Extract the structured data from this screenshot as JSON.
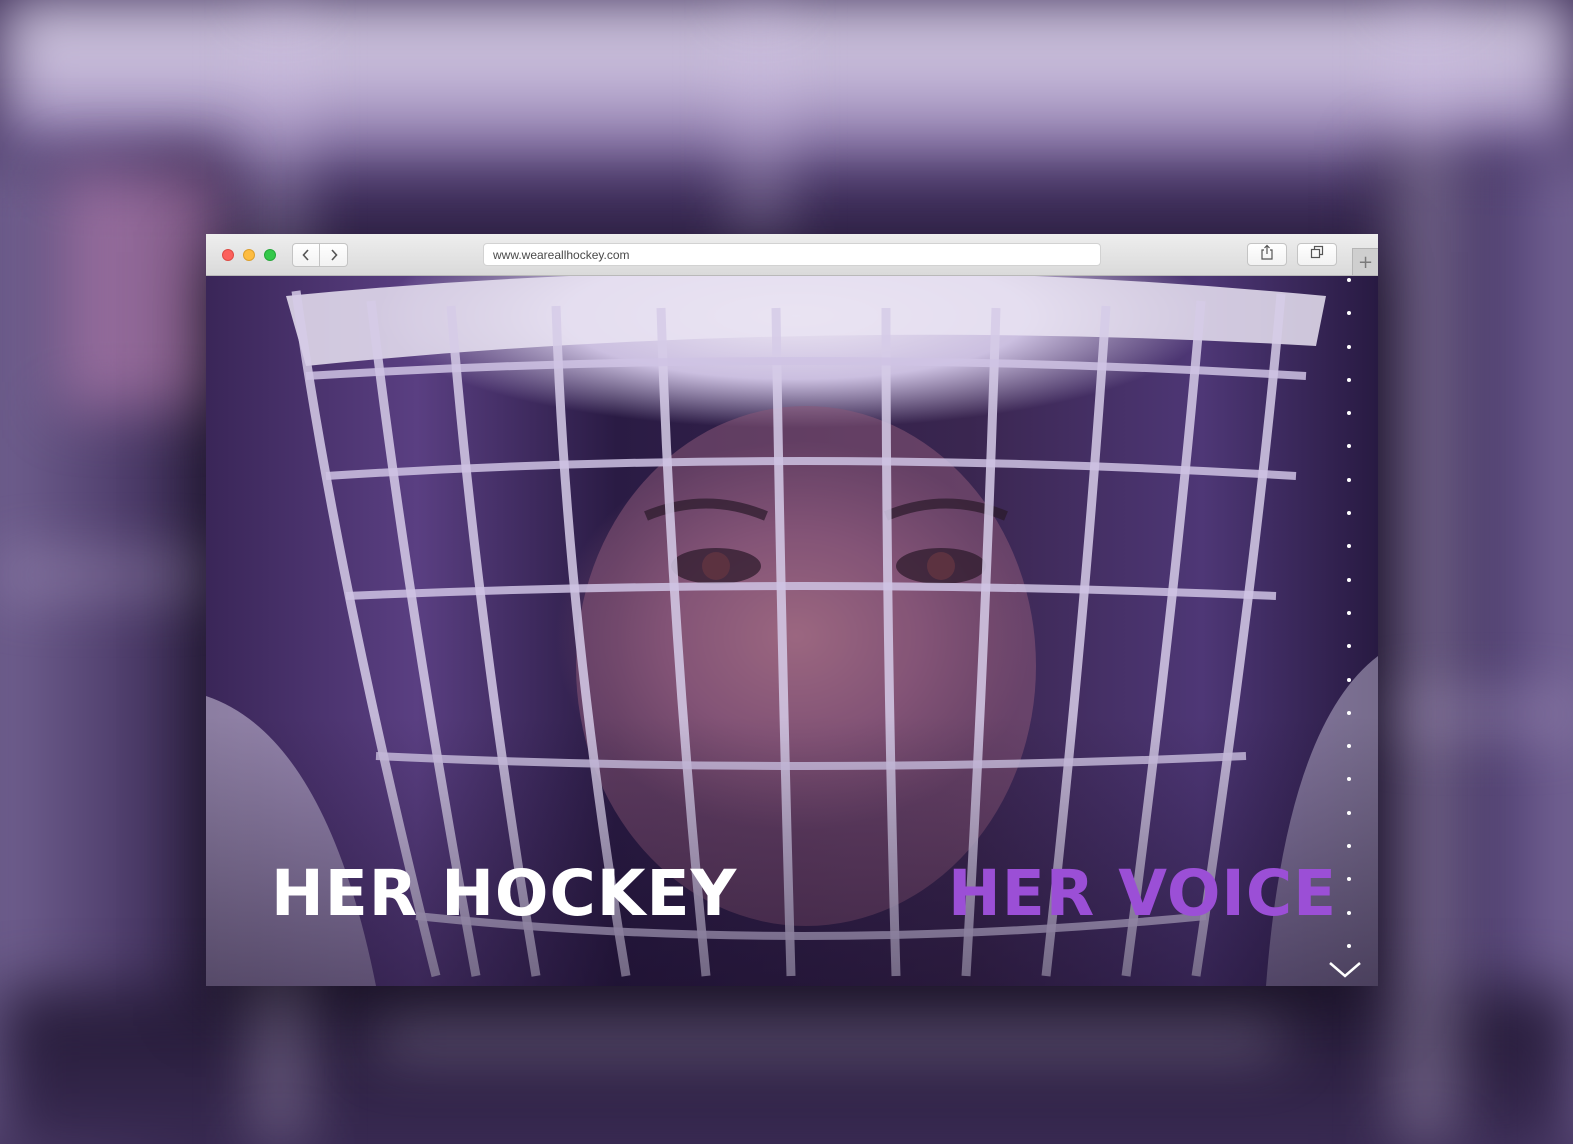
{
  "browser": {
    "url": "www.weareallhockey.com",
    "nav": {
      "back_icon": "chevron-left-icon",
      "forward_icon": "chevron-right-icon"
    },
    "toolbar": {
      "share_icon": "share-icon",
      "tabs_icon": "tab-overview-icon",
      "new_tab_icon": "plus-icon"
    }
  },
  "hero": {
    "headline_left": "HER HOCKEY",
    "headline_right": "HER VOICE",
    "image": "goalie-mask-closeup",
    "scroll_icon": "chevron-down-icon"
  },
  "section_nav": {
    "dot_count": 21
  },
  "colors": {
    "accent": "#9b4fd6",
    "headline_primary": "#ffffff",
    "traffic_close": "#fc605c",
    "traffic_minimize": "#fdbc40",
    "traffic_zoom": "#34c84a"
  }
}
